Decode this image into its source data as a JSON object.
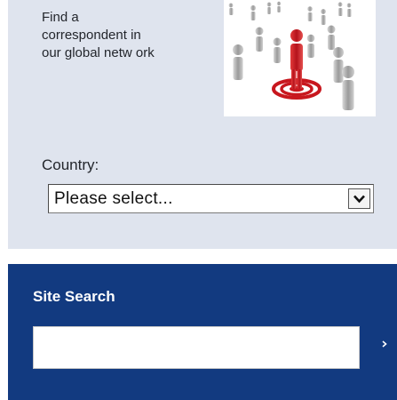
{
  "finder": {
    "intro_lines": [
      "Find a",
      "correspondent in",
      "our global netw ork"
    ],
    "image_icon": "people-network-target-image",
    "country_label": "Country:",
    "country_select": {
      "selected": "Please select...",
      "arrow_icon": "chevron-down-icon"
    }
  },
  "site_search": {
    "title": "Site Search",
    "input_value": "",
    "go_icon": "chevron-right-icon"
  },
  "colors": {
    "finder_bg": "#dfe4ee",
    "search_bg": "#123a80",
    "accent_red": "#c8171e",
    "text": "#23262c"
  }
}
